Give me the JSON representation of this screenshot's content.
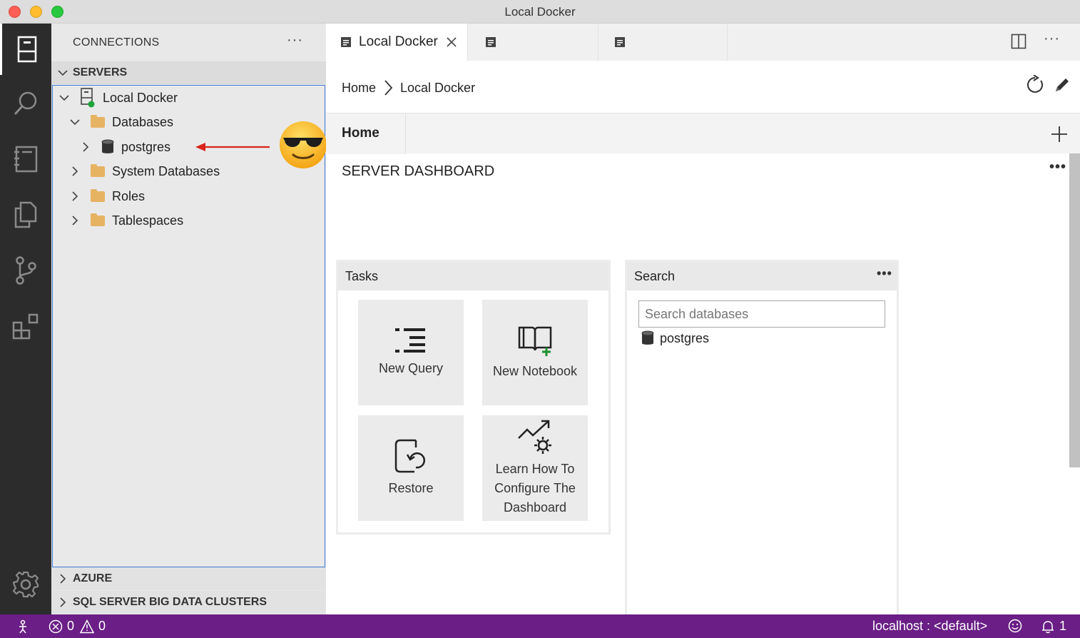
{
  "window": {
    "title": "Local Docker"
  },
  "sidebar": {
    "title": "CONNECTIONS",
    "more": "···",
    "servers_label": "SERVERS",
    "tree": {
      "server": "Local Docker",
      "databases": "Databases",
      "postgres": "postgres",
      "system_databases": "System Databases",
      "roles": "Roles",
      "tablespaces": "Tablespaces"
    },
    "azure_label": "AZURE",
    "bigdata_label": "SQL SERVER BIG DATA CLUSTERS"
  },
  "editor": {
    "tabs": [
      {
        "label": "Local Docker",
        "active": true
      }
    ],
    "more": "···",
    "breadcrumb": {
      "home": "Home",
      "current": "Local Docker"
    },
    "home_tab": "Home",
    "dashboard_title": "SERVER DASHBOARD",
    "dashboard_more": "•••",
    "tasks": {
      "title": "Tasks",
      "items": [
        "New Query",
        "New Notebook",
        "Restore",
        "Learn How To Configure The Dashboard"
      ]
    },
    "search": {
      "title": "Search",
      "more": "•••",
      "placeholder": "Search databases",
      "results": [
        "postgres"
      ]
    }
  },
  "statusbar": {
    "errors": "0",
    "warnings": "0",
    "connection": "localhost : <default>",
    "notifications": "1"
  },
  "colors": {
    "accent": "#6a1e86",
    "selection_border": "#3e7bd6",
    "folder": "#e6b363"
  }
}
